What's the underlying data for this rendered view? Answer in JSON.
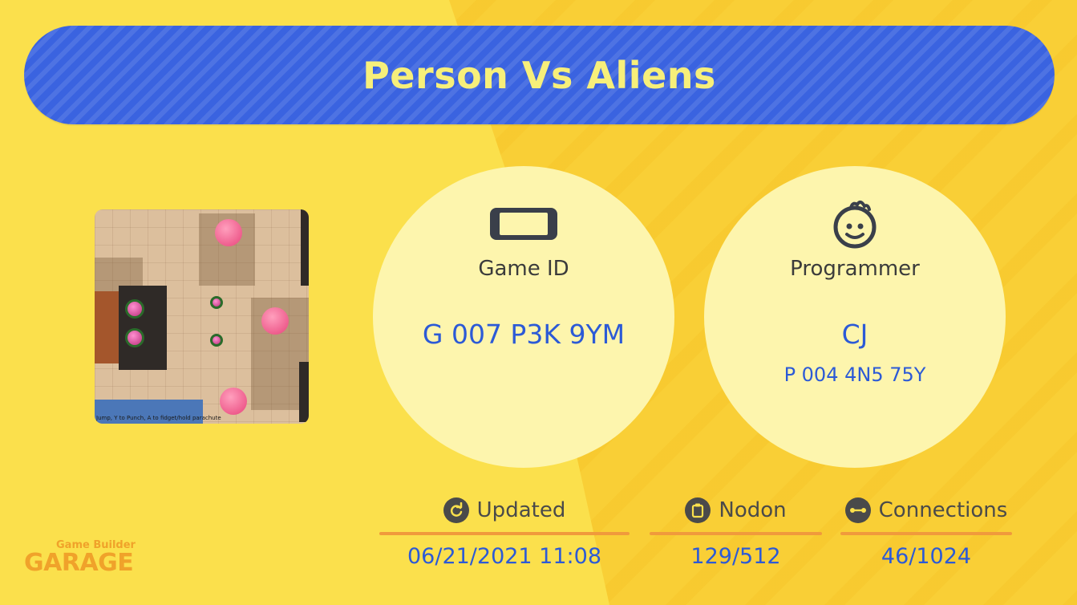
{
  "title": "Person Vs Aliens",
  "thumbnail": {
    "hint_text": "Jump, Y to Punch, A to fidget/hold parachute"
  },
  "game_id": {
    "label": "Game ID",
    "value": "G 007 P3K 9YM",
    "icon": "switch-console-icon"
  },
  "programmer": {
    "label": "Programmer",
    "name": "CJ",
    "id": "P 004 4N5 75Y",
    "icon": "smiley-face-icon"
  },
  "stats": {
    "updated": {
      "label": "Updated",
      "value": "06/21/2021 11:08",
      "icon": "refresh-icon"
    },
    "nodon": {
      "label": "Nodon",
      "value": "129/512",
      "icon": "clipboard-icon"
    },
    "connections": {
      "label": "Connections",
      "value": "46/1024",
      "icon": "link-icon"
    }
  },
  "logo": {
    "line1": "Game Builder",
    "line2": "GARAGE"
  },
  "colors": {
    "background": "#fbe04c",
    "title_bar": "#3a63e0",
    "title_text": "#f7ef7a",
    "circle": "#fdf5ad",
    "value_text": "#2c5ad6",
    "divider": "#f09a3c",
    "logo": "#f0a22a"
  }
}
